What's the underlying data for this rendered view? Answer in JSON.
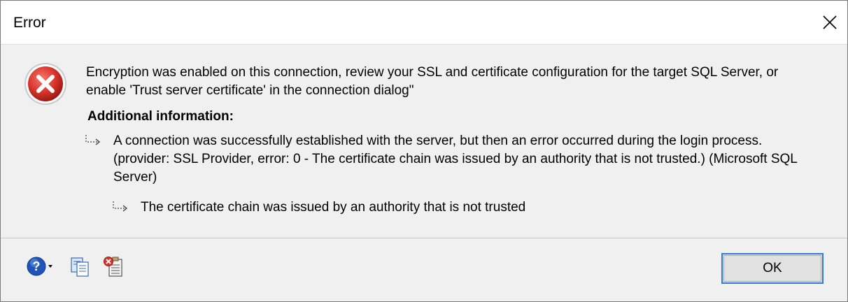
{
  "window": {
    "title": "Error"
  },
  "message": {
    "text": "Encryption was enabled on this connection, review your SSL and certificate configuration for the target SQL Server, or enable 'Trust server certificate' in the connection dialog\""
  },
  "additional": {
    "heading": "Additional information:",
    "details": [
      "A connection was successfully established with the server, but then an error occurred during the login process. (provider: SSL Provider, error: 0 - The certificate chain was issued by an authority that is not trusted.) (Microsoft SQL Server)",
      "The certificate chain was issued by an authority that is not trusted"
    ]
  },
  "toolbar": {
    "icons": [
      "help-icon",
      "copy-icon",
      "show-technical-details-icon"
    ]
  },
  "buttons": {
    "ok_label": "OK"
  },
  "colors": {
    "error_red": "#d9342b",
    "focus_blue": "#2f7bd9",
    "help_blue": "#1f55b8"
  }
}
